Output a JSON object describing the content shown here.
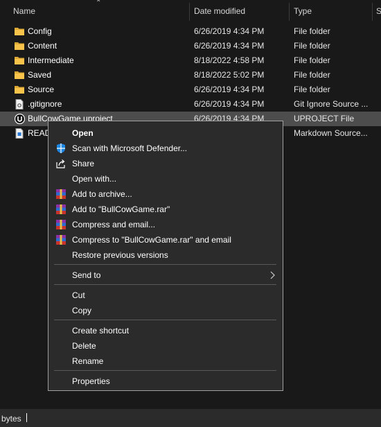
{
  "columns": {
    "name": "Name",
    "date_modified": "Date modified",
    "type": "Type",
    "size_partial": "S"
  },
  "files": [
    {
      "name": "Config",
      "date": "6/26/2019 4:34 PM",
      "type": "File folder",
      "icon": "folder-icon"
    },
    {
      "name": "Content",
      "date": "6/26/2019 4:34 PM",
      "type": "File folder",
      "icon": "folder-icon"
    },
    {
      "name": "Intermediate",
      "date": "8/18/2022 4:58 PM",
      "type": "File folder",
      "icon": "folder-icon"
    },
    {
      "name": "Saved",
      "date": "8/18/2022 5:02 PM",
      "type": "File folder",
      "icon": "folder-icon"
    },
    {
      "name": "Source",
      "date": "6/26/2019 4:34 PM",
      "type": "File folder",
      "icon": "folder-icon"
    },
    {
      "name": ".gitignore",
      "date": "6/26/2019 4:34 PM",
      "type": "Git Ignore Source ...",
      "icon": "gitignore-file-icon"
    },
    {
      "name": "BullCowGame.uproject",
      "date": "6/26/2019 4:34 PM",
      "type": "UPROJECT File",
      "icon": "unreal-engine-icon",
      "selected": true
    },
    {
      "name": "READ",
      "date": "",
      "type": "Markdown Source...",
      "icon": "markdown-file-icon"
    }
  ],
  "context_menu": {
    "open": "Open",
    "scan": "Scan with Microsoft Defender...",
    "share": "Share",
    "open_with": "Open with...",
    "add_archive": "Add to archive...",
    "add_rar": "Add to \"BullCowGame.rar\"",
    "compress_email": "Compress and email...",
    "compress_rar_email": "Compress to \"BullCowGame.rar\" and email",
    "restore": "Restore previous versions",
    "send_to": "Send to",
    "cut": "Cut",
    "copy": "Copy",
    "create_shortcut": "Create shortcut",
    "delete": "Delete",
    "rename": "Rename",
    "properties": "Properties"
  },
  "status_bar": {
    "text": "bytes"
  },
  "colors": {
    "background": "#191919",
    "selected_row": "#4d4d4d",
    "menu_background": "#2b2b2b",
    "folder_yellow": "#f8c34a",
    "defender_blue": "#1e88e5"
  }
}
